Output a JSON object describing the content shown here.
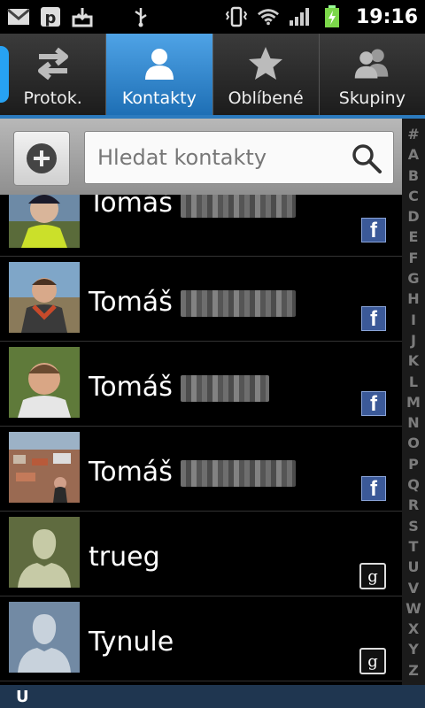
{
  "status_bar": {
    "time": "19:16",
    "icons_left": [
      "gmail-icon",
      "app-p-icon",
      "download-icon",
      "usb-icon"
    ],
    "icons_right": [
      "vibrate-icon",
      "wifi-icon",
      "signal-icon",
      "battery-charging-icon"
    ]
  },
  "tabs": [
    {
      "label": "Protok.",
      "icon": "call-log-icon",
      "active": false
    },
    {
      "label": "Kontakty",
      "icon": "contact-person-icon",
      "active": true
    },
    {
      "label": "Oblíbené",
      "icon": "star-icon",
      "active": false
    },
    {
      "label": "Skupiny",
      "icon": "groups-icon",
      "active": false
    }
  ],
  "search": {
    "placeholder": "Hledat kontakty"
  },
  "alphabet": [
    "#",
    "A",
    "B",
    "C",
    "D",
    "E",
    "F",
    "G",
    "H",
    "I",
    "J",
    "K",
    "L",
    "M",
    "N",
    "O",
    "P",
    "Q",
    "R",
    "S",
    "T",
    "U",
    "V",
    "W",
    "X",
    "Y",
    "Z"
  ],
  "contacts": [
    {
      "name": "Tomáš",
      "source": "facebook"
    },
    {
      "name": "Tomáš",
      "source": "facebook"
    },
    {
      "name": "Tomáš",
      "source": "facebook"
    },
    {
      "name": "Tomáš",
      "source": "facebook"
    },
    {
      "name": "trueg",
      "source": "google"
    },
    {
      "name": "Tynule",
      "source": "google"
    }
  ],
  "section_header": "U",
  "colors": {
    "accent": "#2c7bbf",
    "active_tab": "#3d8fd6",
    "facebook": "#3b5998"
  }
}
